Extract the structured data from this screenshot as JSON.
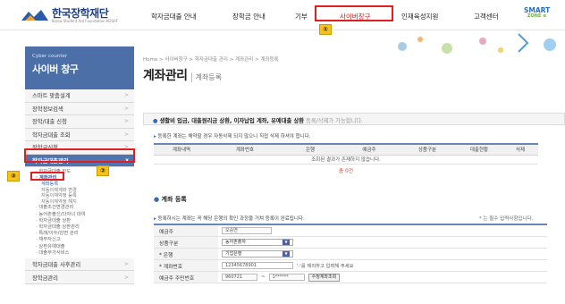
{
  "logo": {
    "ko": "한국장학재단",
    "en": "Korea Student Aid Foundation KOSAF"
  },
  "gnb": [
    {
      "label": "학자금대출 안내"
    },
    {
      "label": "장학금 안내"
    },
    {
      "label": "기부"
    },
    {
      "label": "사이버창구"
    },
    {
      "label": "인재육성지원"
    },
    {
      "label": "고객센터"
    }
  ],
  "smart": {
    "line1": "SMART",
    "line2": "ZONE ⊕"
  },
  "callouts": [
    "①",
    "②",
    "③"
  ],
  "sidebar": {
    "head_small": "Cyber counter",
    "head_big": "사이버 창구",
    "items": [
      {
        "label": "스마트 맞춤설계"
      },
      {
        "label": "장학정보검색"
      },
      {
        "label": "장학/대출 신청"
      },
      {
        "label": "학자금대출 조회"
      },
      {
        "label": "장학금신청"
      },
      {
        "label": "학자금대출관리"
      }
    ],
    "sub_top": [
      "· 학자금대출 한도",
      "· 계좌관리"
    ],
    "sub_sub": [
      "계좌등록",
      "자동이체계좌 변경",
      "자동이체약정 등록",
      "자동이체약정 해지"
    ],
    "sub_bottom": [
      "· 대출조건변경관리",
      "· 농어촌출신/다자녀 대여",
      "· 학자금대출 상환",
      "· 학자금대출 상환관리",
      "· 특례/이두/감면 관리",
      "· 채무자신고",
      "· 상환유예대출",
      "· 대출부가서비스"
    ],
    "bottom_items": [
      {
        "label": "학자금대출 사후관리"
      },
      {
        "label": "장학금관리"
      }
    ],
    "arrow": ">"
  },
  "main": {
    "breadcrumb": "Home > 사이버창구 > 학자금대출 관리 > 계좌관리 > 계좌등록",
    "title": "계좌관리",
    "subtitle": "계좌등록"
  },
  "notice": {
    "bold": "생활비 입금, 대출원리금 상환, 이자납입 계좌, 유예대출 상환",
    "rest": " 등록/삭제가 가능합니다."
  },
  "info_line": "등록한 계좌는 해약할 경우 자동삭제 되지 않으니 직접 삭제 하셔야 합니다.",
  "table": {
    "headers": [
      "계좌내역",
      "계좌번호",
      "은행",
      "예금주",
      "상품구분",
      "대출현황",
      "삭제"
    ],
    "empty": "조회된 결과가 존재하지 않습니다.",
    "summary": "총 0건"
  },
  "register": {
    "title": "계좌 등록",
    "info": "등록하시는 계좌는 꼭 해당 은행의 확인 과정을 거쳐 등록이 완료됩니다.",
    "required_note": "* 는 필수 입력사항입니다.",
    "rows": [
      {
        "label": "예금주",
        "value": "오승연"
      },
      {
        "label": "상품구분",
        "value": "농어촌출자"
      },
      {
        "label": "* 은행",
        "value": "기업은행"
      },
      {
        "label": "* 계좌번호",
        "value": "12345678901",
        "hint": "'-'를 제외하고 입력해 주세요"
      },
      {
        "label": "예금주 주민번호",
        "value1": "960721",
        "sep": "~",
        "value2": "1******",
        "button": "수정계좌조회"
      }
    ]
  },
  "colors": {
    "accent": "#5174b0",
    "highlight_red": "#e02020",
    "callout_yellow": "#f6c21a"
  }
}
